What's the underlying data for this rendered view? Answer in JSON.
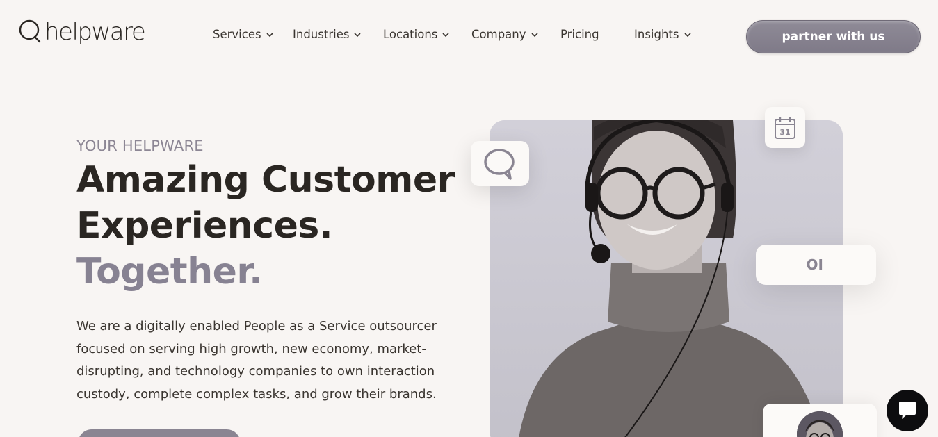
{
  "header": {
    "logo_text": "helpware",
    "nav": [
      {
        "label": "Services",
        "has_dropdown": true
      },
      {
        "label": "Industries",
        "has_dropdown": true
      },
      {
        "label": "Locations",
        "has_dropdown": true
      },
      {
        "label": "Company",
        "has_dropdown": true
      },
      {
        "label": "Pricing",
        "has_dropdown": false
      },
      {
        "label": "Insights",
        "has_dropdown": true
      }
    ],
    "cta_label": "partner with us"
  },
  "hero": {
    "eyebrow": "YOUR HELPWARE",
    "title_line1": "Amazing Customer",
    "title_line2": "Experiences.",
    "title_line3": "Together.",
    "description": "We are a digitally enabled People as a Service outsourcer focused on serving high growth, new economy, market-disrupting, and technology companies to own interaction custody, complete complex tasks, and grow their brands."
  },
  "visual": {
    "calendar_day": "31",
    "typing_text": "OI",
    "chat_icon": "chat-bubble-icon",
    "calendar_icon": "calendar-icon"
  },
  "colors": {
    "background": "#f8f5f3",
    "accent": "#878292",
    "text_dark": "#2a2622",
    "chat_button": "#0d0d0f"
  }
}
